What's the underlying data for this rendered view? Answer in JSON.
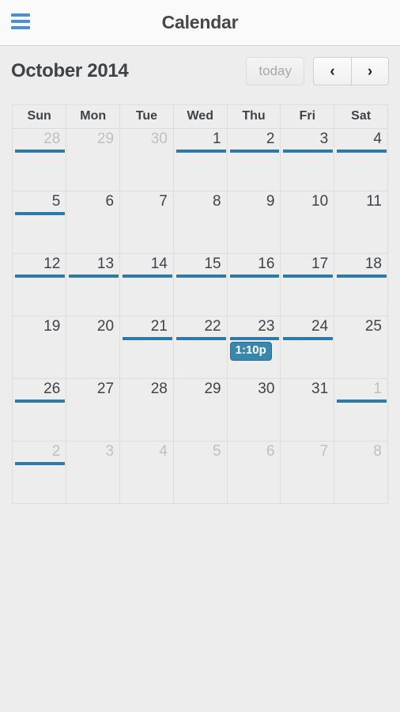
{
  "navbar": {
    "title": "Calendar",
    "menu_icon": "hamburger-menu-icon"
  },
  "toolbar": {
    "title": "October 2014",
    "today_label": "today",
    "prev_label": "‹",
    "next_label": "›"
  },
  "calendar": {
    "weekdays": [
      "Sun",
      "Mon",
      "Tue",
      "Wed",
      "Thu",
      "Fri",
      "Sat"
    ],
    "accent_blue": "#2b7aa8",
    "today_highlight": "#fcf8e3",
    "event_color": "#3a87ad",
    "weeks": [
      [
        {
          "day": "28",
          "other_month": true,
          "bar": true,
          "today": false,
          "events": []
        },
        {
          "day": "29",
          "other_month": true,
          "bar": false,
          "today": false,
          "events": []
        },
        {
          "day": "30",
          "other_month": true,
          "bar": false,
          "today": false,
          "events": []
        },
        {
          "day": "1",
          "other_month": false,
          "bar": true,
          "today": false,
          "events": []
        },
        {
          "day": "2",
          "other_month": false,
          "bar": true,
          "today": false,
          "events": []
        },
        {
          "day": "3",
          "other_month": false,
          "bar": true,
          "today": false,
          "events": []
        },
        {
          "day": "4",
          "other_month": false,
          "bar": true,
          "today": false,
          "events": []
        }
      ],
      [
        {
          "day": "5",
          "other_month": false,
          "bar": true,
          "today": false,
          "events": []
        },
        {
          "day": "6",
          "other_month": false,
          "bar": false,
          "today": false,
          "events": []
        },
        {
          "day": "7",
          "other_month": false,
          "bar": false,
          "today": false,
          "events": []
        },
        {
          "day": "8",
          "other_month": false,
          "bar": false,
          "today": false,
          "events": []
        },
        {
          "day": "9",
          "other_month": false,
          "bar": false,
          "today": false,
          "events": []
        },
        {
          "day": "10",
          "other_month": false,
          "bar": false,
          "today": false,
          "events": []
        },
        {
          "day": "11",
          "other_month": false,
          "bar": false,
          "today": false,
          "events": []
        }
      ],
      [
        {
          "day": "12",
          "other_month": false,
          "bar": true,
          "today": false,
          "events": []
        },
        {
          "day": "13",
          "other_month": false,
          "bar": true,
          "today": false,
          "events": []
        },
        {
          "day": "14",
          "other_month": false,
          "bar": true,
          "today": false,
          "events": []
        },
        {
          "day": "15",
          "other_month": false,
          "bar": true,
          "today": false,
          "events": []
        },
        {
          "day": "16",
          "other_month": false,
          "bar": true,
          "today": false,
          "events": []
        },
        {
          "day": "17",
          "other_month": false,
          "bar": true,
          "today": false,
          "events": []
        },
        {
          "day": "18",
          "other_month": false,
          "bar": true,
          "today": false,
          "events": []
        }
      ],
      [
        {
          "day": "19",
          "other_month": false,
          "bar": false,
          "today": false,
          "events": []
        },
        {
          "day": "20",
          "other_month": false,
          "bar": false,
          "today": false,
          "events": []
        },
        {
          "day": "21",
          "other_month": false,
          "bar": true,
          "today": false,
          "events": []
        },
        {
          "day": "22",
          "other_month": false,
          "bar": true,
          "today": false,
          "events": []
        },
        {
          "day": "23",
          "other_month": false,
          "bar": true,
          "today": true,
          "events": [
            "1:10p"
          ]
        },
        {
          "day": "24",
          "other_month": false,
          "bar": true,
          "today": false,
          "events": []
        },
        {
          "day": "25",
          "other_month": false,
          "bar": false,
          "today": false,
          "events": []
        }
      ],
      [
        {
          "day": "26",
          "other_month": false,
          "bar": true,
          "today": false,
          "events": []
        },
        {
          "day": "27",
          "other_month": false,
          "bar": false,
          "today": false,
          "events": []
        },
        {
          "day": "28",
          "other_month": false,
          "bar": false,
          "today": false,
          "events": []
        },
        {
          "day": "29",
          "other_month": false,
          "bar": false,
          "today": false,
          "events": []
        },
        {
          "day": "30",
          "other_month": false,
          "bar": false,
          "today": false,
          "events": []
        },
        {
          "day": "31",
          "other_month": false,
          "bar": false,
          "today": false,
          "events": []
        },
        {
          "day": "1",
          "other_month": true,
          "bar": true,
          "today": false,
          "events": []
        }
      ],
      [
        {
          "day": "2",
          "other_month": true,
          "bar": true,
          "today": false,
          "events": []
        },
        {
          "day": "3",
          "other_month": true,
          "bar": false,
          "today": false,
          "events": []
        },
        {
          "day": "4",
          "other_month": true,
          "bar": false,
          "today": false,
          "events": []
        },
        {
          "day": "5",
          "other_month": true,
          "bar": false,
          "today": false,
          "events": []
        },
        {
          "day": "6",
          "other_month": true,
          "bar": false,
          "today": false,
          "events": []
        },
        {
          "day": "7",
          "other_month": true,
          "bar": false,
          "today": false,
          "events": []
        },
        {
          "day": "8",
          "other_month": true,
          "bar": false,
          "today": false,
          "events": []
        }
      ]
    ]
  }
}
